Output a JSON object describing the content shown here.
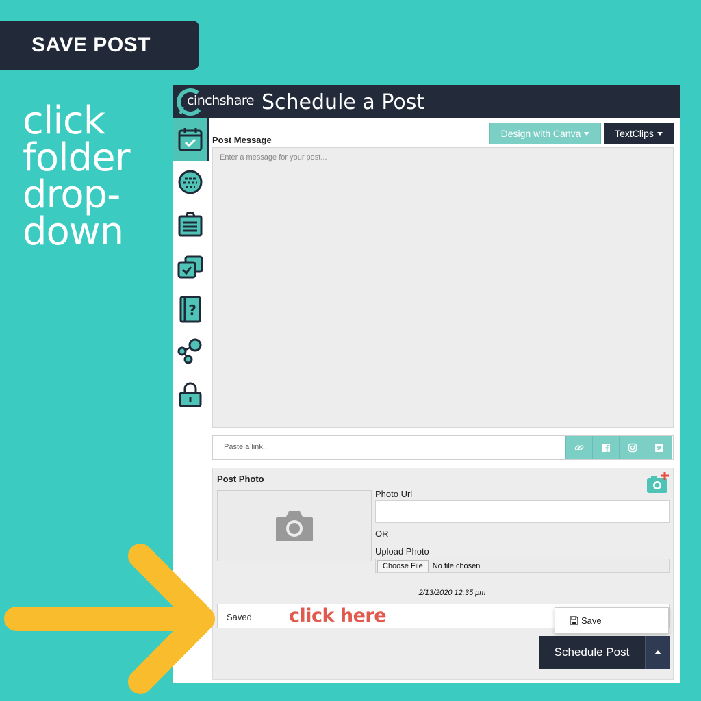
{
  "badge": {
    "label": "SAVE POST"
  },
  "instructions": {
    "lines": [
      "click",
      "folder",
      "drop-",
      "down"
    ]
  },
  "header": {
    "logo_text": "cinchshare",
    "title": "Schedule a Post"
  },
  "sidebar": {
    "items": [
      {
        "icon": "calendar-check-icon",
        "active": true
      },
      {
        "icon": "chat-bubble-icon",
        "active": false
      },
      {
        "icon": "clipboard-icon",
        "active": false
      },
      {
        "icon": "stacked-check-icon",
        "active": false
      },
      {
        "icon": "help-book-icon",
        "active": false
      },
      {
        "icon": "share-nodes-icon",
        "active": false
      },
      {
        "icon": "lock-icon",
        "active": false
      }
    ]
  },
  "post_message": {
    "label": "Post Message",
    "placeholder": "Enter a message for your post...",
    "canva_button": "Design with Canva",
    "textclips_button": "TextClips"
  },
  "link_bar": {
    "placeholder": "Paste a link...",
    "buttons": [
      "link-icon",
      "facebook-icon",
      "instagram-icon",
      "twitter-icon"
    ]
  },
  "post_photo": {
    "label": "Post Photo",
    "photo_url_label": "Photo Url",
    "or_label": "OR",
    "upload_label": "Upload Photo",
    "choose_file": "Choose File",
    "no_file": "No file chosen"
  },
  "schedule": {
    "timestamp": "2/13/2020 12:35 pm",
    "status": "Saved",
    "dropdown_save": "Save",
    "button_label": "Schedule Post"
  },
  "annotation": {
    "click_here": "click here"
  },
  "colors": {
    "background": "#3ccbc0",
    "navy": "#232b3b",
    "teal": "#7ccfc4",
    "accent_red": "#e05a4e",
    "arrow": "#f9bc2c"
  }
}
